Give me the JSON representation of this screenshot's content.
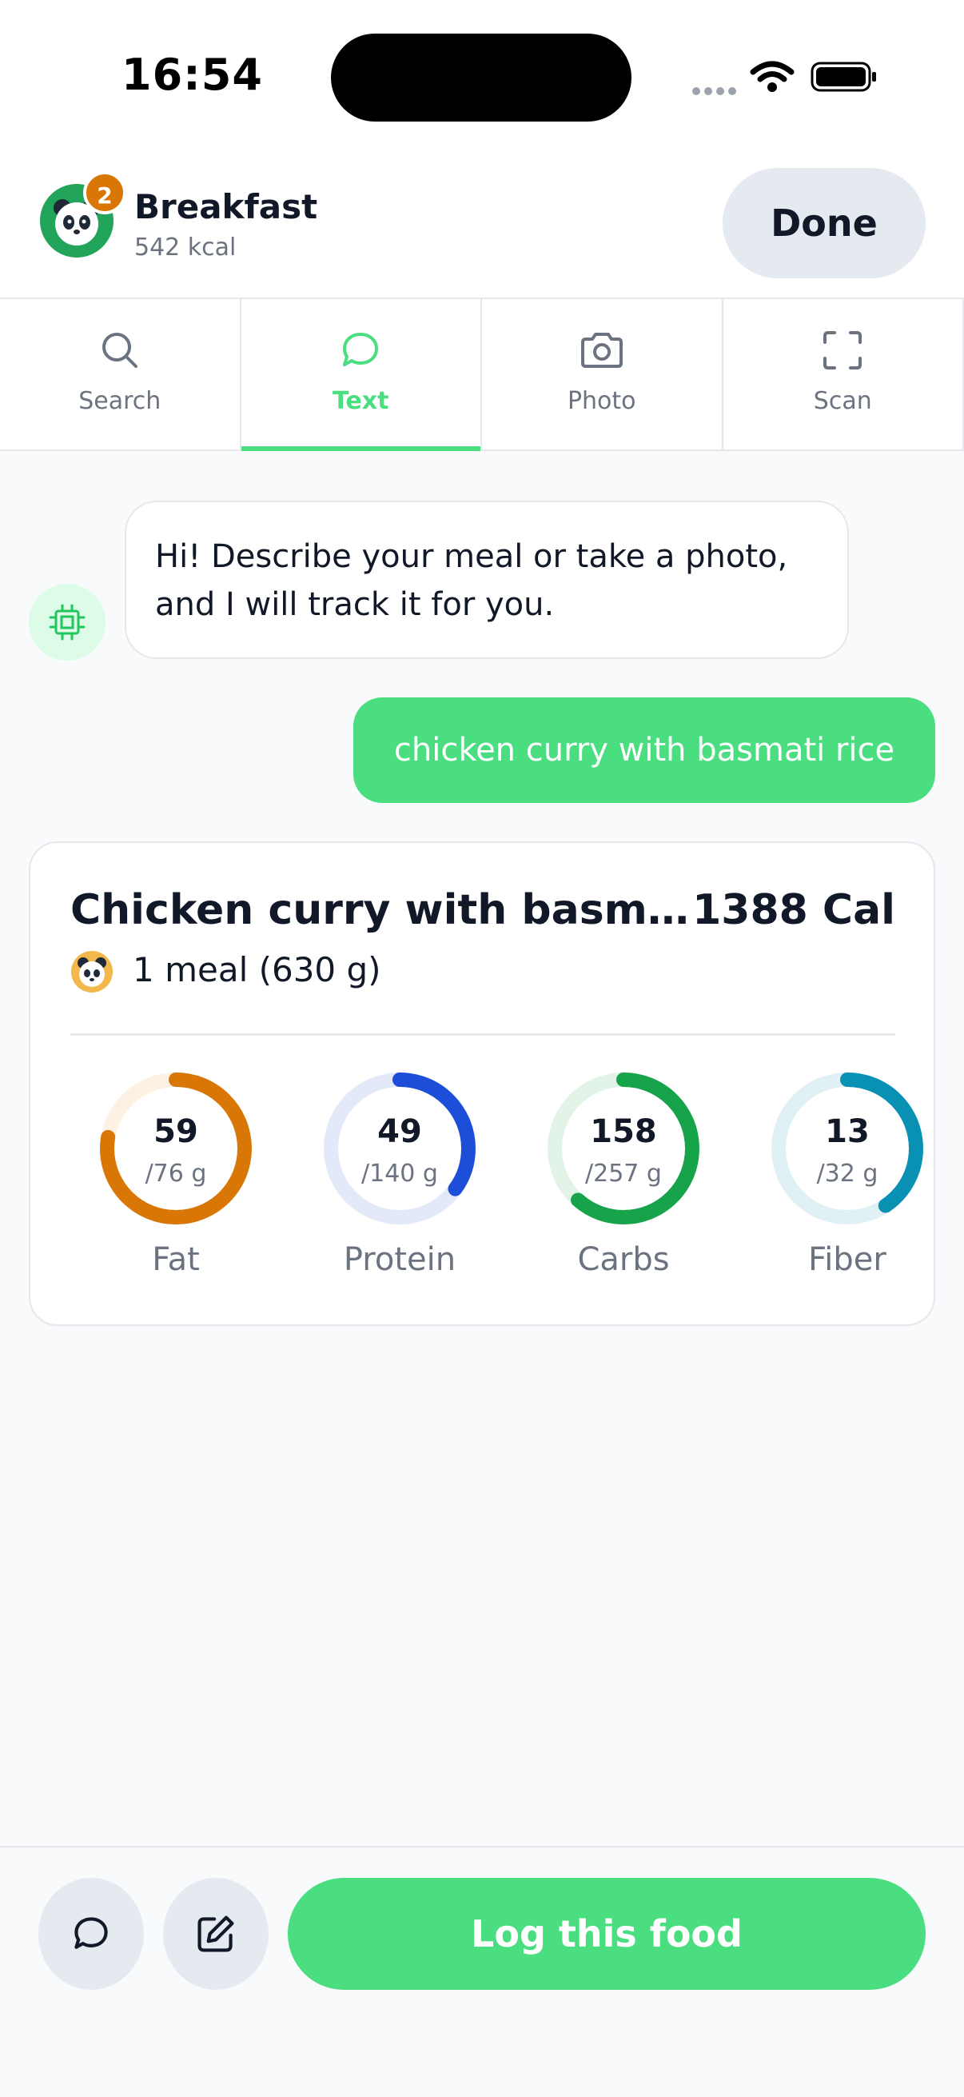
{
  "status_bar": {
    "time": "16:54"
  },
  "header": {
    "meal_title": "Breakfast",
    "meal_kcal": "542 kcal",
    "badge_count": "2",
    "done_label": "Done"
  },
  "tabs": [
    {
      "label": "Search",
      "icon": "search-icon",
      "active": false
    },
    {
      "label": "Text",
      "icon": "chat-bubble-icon",
      "active": true
    },
    {
      "label": "Photo",
      "icon": "camera-icon",
      "active": false
    },
    {
      "label": "Scan",
      "icon": "scan-frame-icon",
      "active": false
    }
  ],
  "chat": {
    "bot_message": "Hi! Describe your meal or take a photo, and I will track it for you.",
    "user_message": "chicken curry with basmati rice"
  },
  "food_result": {
    "name": "Chicken curry with basmati rice",
    "calories": "1388 Cal",
    "portion": "1 meal (630 g)",
    "macros": [
      {
        "label": "Fat",
        "value": "59",
        "target": "/76 g",
        "ratio": 0.776,
        "color": "#d97706",
        "track": "#fdf1e3"
      },
      {
        "label": "Protein",
        "value": "49",
        "target": "/140 g",
        "ratio": 0.35,
        "color": "#1d4ed8",
        "track": "#e4e9fa"
      },
      {
        "label": "Carbs",
        "value": "158",
        "target": "/257 g",
        "ratio": 0.615,
        "color": "#16a34a",
        "track": "#e2f4e8"
      },
      {
        "label": "Fiber",
        "value": "13",
        "target": "/32 g",
        "ratio": 0.406,
        "color": "#0891b2",
        "track": "#e0f1f5"
      }
    ]
  },
  "bottom_bar": {
    "log_label": "Log this food"
  },
  "colors": {
    "accent": "#4ade80",
    "badge": "#d97706",
    "avatar_bg": "#22a55b"
  }
}
